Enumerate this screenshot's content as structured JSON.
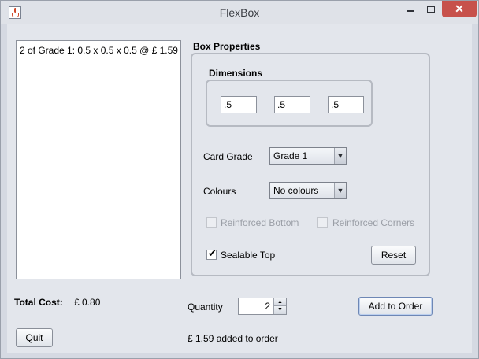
{
  "window": {
    "title": "FlexBox",
    "close_glyph": "✕"
  },
  "icons": {
    "app": "java-cup-icon",
    "minimize": "minimize-icon",
    "maximize": "maximize-icon",
    "close": "close-icon"
  },
  "order_list": {
    "items": [
      "2 of Grade 1: 0.5 x 0.5 x 0.5 @ £ 1.59"
    ]
  },
  "box_properties": {
    "title": "Box Properties",
    "dimensions": {
      "title": "Dimensions",
      "values": [
        ".5",
        ".5",
        ".5"
      ]
    },
    "card_grade": {
      "label": "Card Grade",
      "selected": "Grade 1"
    },
    "colours": {
      "label": "Colours",
      "selected": "No colours"
    },
    "reinforced_bottom": {
      "label": "Reinforced Bottom",
      "checked": false,
      "enabled": false
    },
    "reinforced_corners": {
      "label": "Reinforced Corners",
      "checked": false,
      "enabled": false
    },
    "sealable_top": {
      "label": "Sealable Top",
      "checked": true,
      "check_glyph": "✔"
    },
    "reset_label": "Reset"
  },
  "summary": {
    "total_cost_label": "Total Cost:",
    "total_cost_value": "£ 0.80"
  },
  "quantity": {
    "label": "Quantity",
    "value": "2",
    "up_glyph": "▲",
    "down_glyph": "▼"
  },
  "add_to_order_label": "Add to Order",
  "status_message": "£ 1.59 added to order",
  "quit_label": "Quit",
  "dropdown_arrow": "▼"
}
